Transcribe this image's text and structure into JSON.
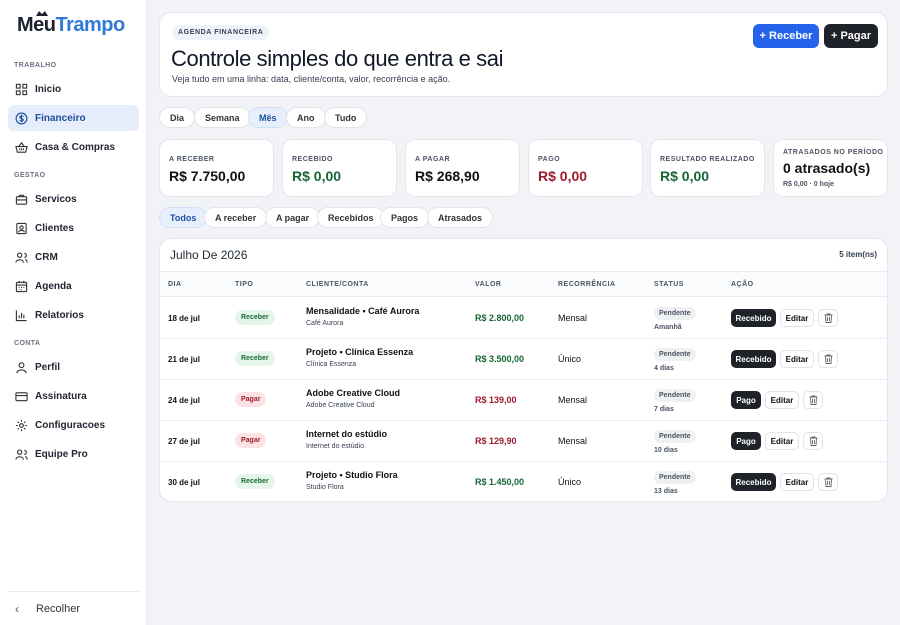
{
  "brand": {
    "part1": "Meu",
    "part2": "Trampo"
  },
  "sidebar": {
    "sections": [
      "TRABALHO",
      "GESTAO",
      "CONTA"
    ],
    "items": [
      {
        "label": "Inicio",
        "icon": "grid-icon"
      },
      {
        "label": "Financeiro",
        "icon": "dollar-icon",
        "active": true
      },
      {
        "label": "Casa & Compras",
        "icon": "basket-icon"
      },
      {
        "label": "Servicos",
        "icon": "briefcase-icon"
      },
      {
        "label": "Clientes",
        "icon": "contact-icon"
      },
      {
        "label": "CRM",
        "icon": "users-icon"
      },
      {
        "label": "Agenda",
        "icon": "calendar-icon"
      },
      {
        "label": "Relatorios",
        "icon": "chart-icon"
      },
      {
        "label": "Perfil",
        "icon": "user-icon"
      },
      {
        "label": "Assinatura",
        "icon": "card-icon"
      },
      {
        "label": "Configuracoes",
        "icon": "gear-icon"
      },
      {
        "label": "Equipe Pro",
        "icon": "team-icon"
      }
    ],
    "collapse_label": "Recolher"
  },
  "header": {
    "eyebrow": "AGENDA FINANCEIRA",
    "title": "Controle simples do que entra e sai",
    "subtitle": "Veja tudo em uma linha: data, cliente/conta, valor, recorrência e ação.",
    "receive_label": "+ Receber",
    "pay_label": "+ Pagar"
  },
  "period_tabs": [
    "Dia",
    "Semana",
    "Mês",
    "Ano",
    "Tudo"
  ],
  "period_active": "Mês",
  "stats": [
    {
      "label": "A RECEBER",
      "value": "R$ 7.750,00",
      "tone": "dark"
    },
    {
      "label": "RECEBIDO",
      "value": "R$ 0,00",
      "tone": "green"
    },
    {
      "label": "A PAGAR",
      "value": "R$ 268,90",
      "tone": "dark"
    },
    {
      "label": "PAGO",
      "value": "R$ 0,00",
      "tone": "red"
    },
    {
      "label": "RESULTADO REALIZADO",
      "value": "R$ 0,00",
      "tone": "green"
    },
    {
      "label": "ATRASADOS NO PERÍODO",
      "value": "0 atrasado(s)",
      "sub": "R$ 0,00 · 0 hoje",
      "tone": "dark"
    }
  ],
  "filter_tabs": [
    "Todos",
    "A receber",
    "A pagar",
    "Recebidos",
    "Pagos",
    "Atrasados"
  ],
  "filter_active": "Todos",
  "table": {
    "month": "Julho De 2026",
    "count": "5 item(ns)",
    "columns": [
      "DIA",
      "TIPO",
      "CLIENTE/CONTA",
      "VALOR",
      "RECORRÊNCIA",
      "STATUS",
      "AÇÃO"
    ],
    "rows": [
      {
        "day": "18 de jul",
        "type": "Receber",
        "kind": "in",
        "name": "Mensalidade • Café Aurora",
        "sub": "Café Aurora",
        "value": "R$ 2.800,00",
        "recurrence": "Mensal",
        "status": "Pendente",
        "when": "Amanhã",
        "action": "Recebido",
        "edit": "Editar"
      },
      {
        "day": "21 de jul",
        "type": "Receber",
        "kind": "in",
        "name": "Projeto • Clínica Essenza",
        "sub": "Clínica Essenza",
        "value": "R$ 3.500,00",
        "recurrence": "Único",
        "status": "Pendente",
        "when": "4 dias",
        "action": "Recebido",
        "edit": "Editar"
      },
      {
        "day": "24 de jul",
        "type": "Pagar",
        "kind": "out",
        "name": "Adobe Creative Cloud",
        "sub": "Adobe Creative Cloud",
        "value": "R$ 139,00",
        "recurrence": "Mensal",
        "status": "Pendente",
        "when": "7 dias",
        "action": "Pago",
        "edit": "Editar"
      },
      {
        "day": "27 de jul",
        "type": "Pagar",
        "kind": "out",
        "name": "Internet do estúdio",
        "sub": "Internet do estúdio",
        "value": "R$ 129,90",
        "recurrence": "Mensal",
        "status": "Pendente",
        "when": "10 dias",
        "action": "Pago",
        "edit": "Editar"
      },
      {
        "day": "30 de jul",
        "type": "Receber",
        "kind": "in",
        "name": "Projeto • Studio Flora",
        "sub": "Studio Flora",
        "value": "R$ 1.450,00",
        "recurrence": "Único",
        "status": "Pendente",
        "when": "13 dias",
        "action": "Recebido",
        "edit": "Editar"
      }
    ]
  },
  "colors": {
    "accent": "#2563eb",
    "dark": "#1f2329",
    "green": "#166534",
    "red": "#9b1c2c"
  }
}
